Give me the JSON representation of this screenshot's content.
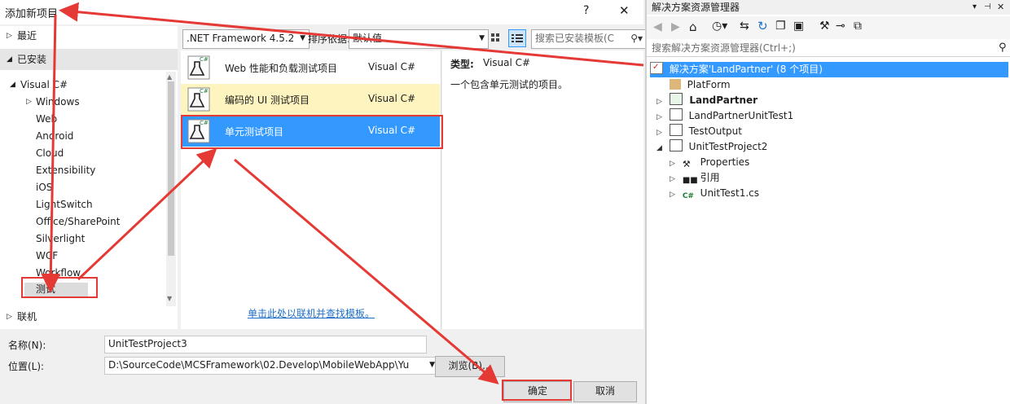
{
  "dialog": {
    "title": "添加新项目",
    "help_glyph": "?",
    "close_glyph": "✕",
    "nav": {
      "recent": "最近",
      "installed": "已安装",
      "visual_csharp": "Visual C#",
      "items": [
        "Windows",
        "Web",
        "Android",
        "Cloud",
        "Extensibility",
        "iOS",
        "LightSwitch",
        "Office/SharePoint",
        "Silverlight",
        "WCF",
        "Workflow",
        "测试"
      ],
      "online": "联机"
    },
    "framework": ".NET Framework 4.5.2",
    "sort_label": "排序依据:",
    "sort_value": "默认值",
    "search_placeholder": "搜索已安装模板(C",
    "templates": [
      {
        "name": "Web 性能和负载测试项目",
        "lang": "Visual C#"
      },
      {
        "name": "编码的 UI 测试项目",
        "lang": "Visual C#"
      },
      {
        "name": "单元测试项目",
        "lang": "Visual C#"
      }
    ],
    "online_link": "单击此处以联机并查找模板。",
    "desc": {
      "type_label": "类型:",
      "type_value": "Visual C#",
      "text": "一个包含单元测试的项目。"
    },
    "name_label": "名称(N):",
    "name_value": "UnitTestProject3",
    "location_label": "位置(L):",
    "location_value": "D:\\SourceCode\\MCSFramework\\02.Develop\\MobileWebApp\\Yu",
    "browse": "浏览(B)...",
    "ok": "确定",
    "cancel": "取消"
  },
  "solution": {
    "title": "解决方案资源管理器",
    "search_placeholder": "搜索解决方案资源管理器(Ctrl+;)",
    "root": "解决方案'LandPartner' (8 个项目)",
    "items": [
      "PlatForm",
      "LandPartner",
      "LandPartnerUnitTest1",
      "TestOutput",
      "UnitTestProject2",
      "Properties",
      "引用",
      "UnitTest1.cs"
    ]
  },
  "colors": {
    "selection": "#3399ff",
    "accent_red": "#e53935",
    "hover": "#fdf4bf"
  }
}
